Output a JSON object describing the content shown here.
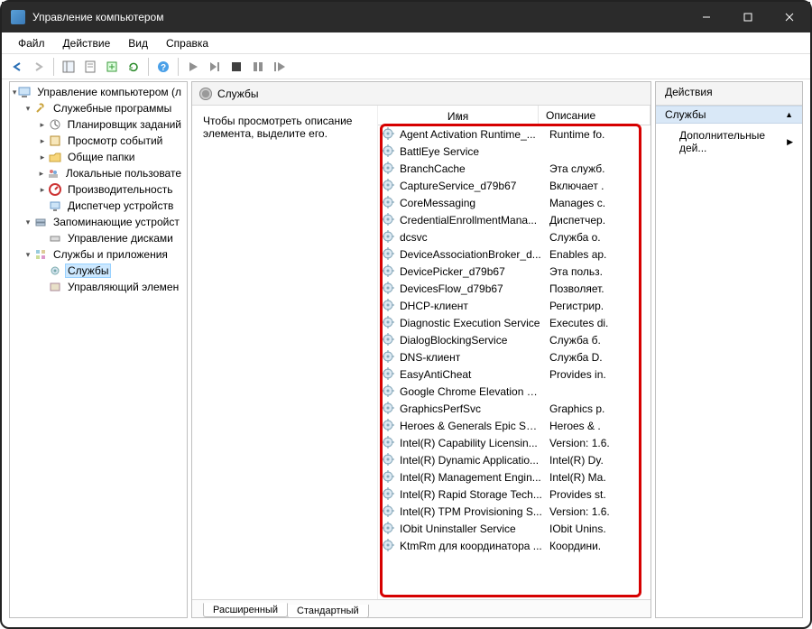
{
  "window": {
    "title": "Управление компьютером"
  },
  "menus": {
    "file": "Файл",
    "action": "Действие",
    "view": "Вид",
    "help": "Справка"
  },
  "tree": {
    "root": "Управление компьютером (л",
    "utilities": "Служебные программы",
    "utilities_items": {
      "scheduler": "Планировщик заданий",
      "eventviewer": "Просмотр событий",
      "shared": "Общие папки",
      "localusers": "Локальные пользовате",
      "performance": "Производительность",
      "devmgr": "Диспетчер устройств"
    },
    "storage": "Запоминающие устройст",
    "storage_items": {
      "diskmgmt": "Управление дисками"
    },
    "svcapps": "Службы и приложения",
    "svcapps_items": {
      "services": "Службы",
      "wmi": "Управляющий элемен"
    }
  },
  "center": {
    "title": "Службы",
    "hint": "Чтобы просмотреть описание элемента, выделите его.",
    "col_name": "Имя",
    "col_desc": "Описание",
    "tabs": {
      "extended": "Расширенный",
      "standard": "Стандартный"
    }
  },
  "services": [
    {
      "name": "Agent Activation Runtime_...",
      "desc": "Runtime fo."
    },
    {
      "name": "BattlEye Service",
      "desc": ""
    },
    {
      "name": "BranchCache",
      "desc": "Эта служб."
    },
    {
      "name": "CaptureService_d79b67",
      "desc": "Включает ."
    },
    {
      "name": "CoreMessaging",
      "desc": "Manages c."
    },
    {
      "name": "CredentialEnrollmentMana...",
      "desc": "Диспетчер."
    },
    {
      "name": "dcsvc",
      "desc": "Служба о."
    },
    {
      "name": "DeviceAssociationBroker_d...",
      "desc": "Enables ap."
    },
    {
      "name": "DevicePicker_d79b67",
      "desc": "Эта польз."
    },
    {
      "name": "DevicesFlow_d79b67",
      "desc": "Позволяет."
    },
    {
      "name": "DHCP-клиент",
      "desc": "Регистрир."
    },
    {
      "name": "Diagnostic Execution Service",
      "desc": "Executes di."
    },
    {
      "name": "DialogBlockingService",
      "desc": "Служба б."
    },
    {
      "name": "DNS-клиент",
      "desc": "Служба D."
    },
    {
      "name": "EasyAntiCheat",
      "desc": "Provides in."
    },
    {
      "name": "Google Chrome Elevation S...",
      "desc": ""
    },
    {
      "name": "GraphicsPerfSvc",
      "desc": "Graphics p."
    },
    {
      "name": "Heroes & Generals Epic Ser...",
      "desc": "Heroes & ."
    },
    {
      "name": "Intel(R) Capability Licensin...",
      "desc": "Version: 1.6."
    },
    {
      "name": "Intel(R) Dynamic Applicatio...",
      "desc": "Intel(R) Dy."
    },
    {
      "name": "Intel(R) Management Engin...",
      "desc": "Intel(R) Ma."
    },
    {
      "name": "Intel(R) Rapid Storage Tech...",
      "desc": "Provides st."
    },
    {
      "name": "Intel(R) TPM Provisioning S...",
      "desc": "Version: 1.6."
    },
    {
      "name": "IObit Uninstaller Service",
      "desc": "IObit Unins."
    },
    {
      "name": "KtmRm для координатора ...",
      "desc": "Координи."
    }
  ],
  "actions": {
    "header": "Действия",
    "group": "Службы",
    "more": "Дополнительные дей..."
  }
}
